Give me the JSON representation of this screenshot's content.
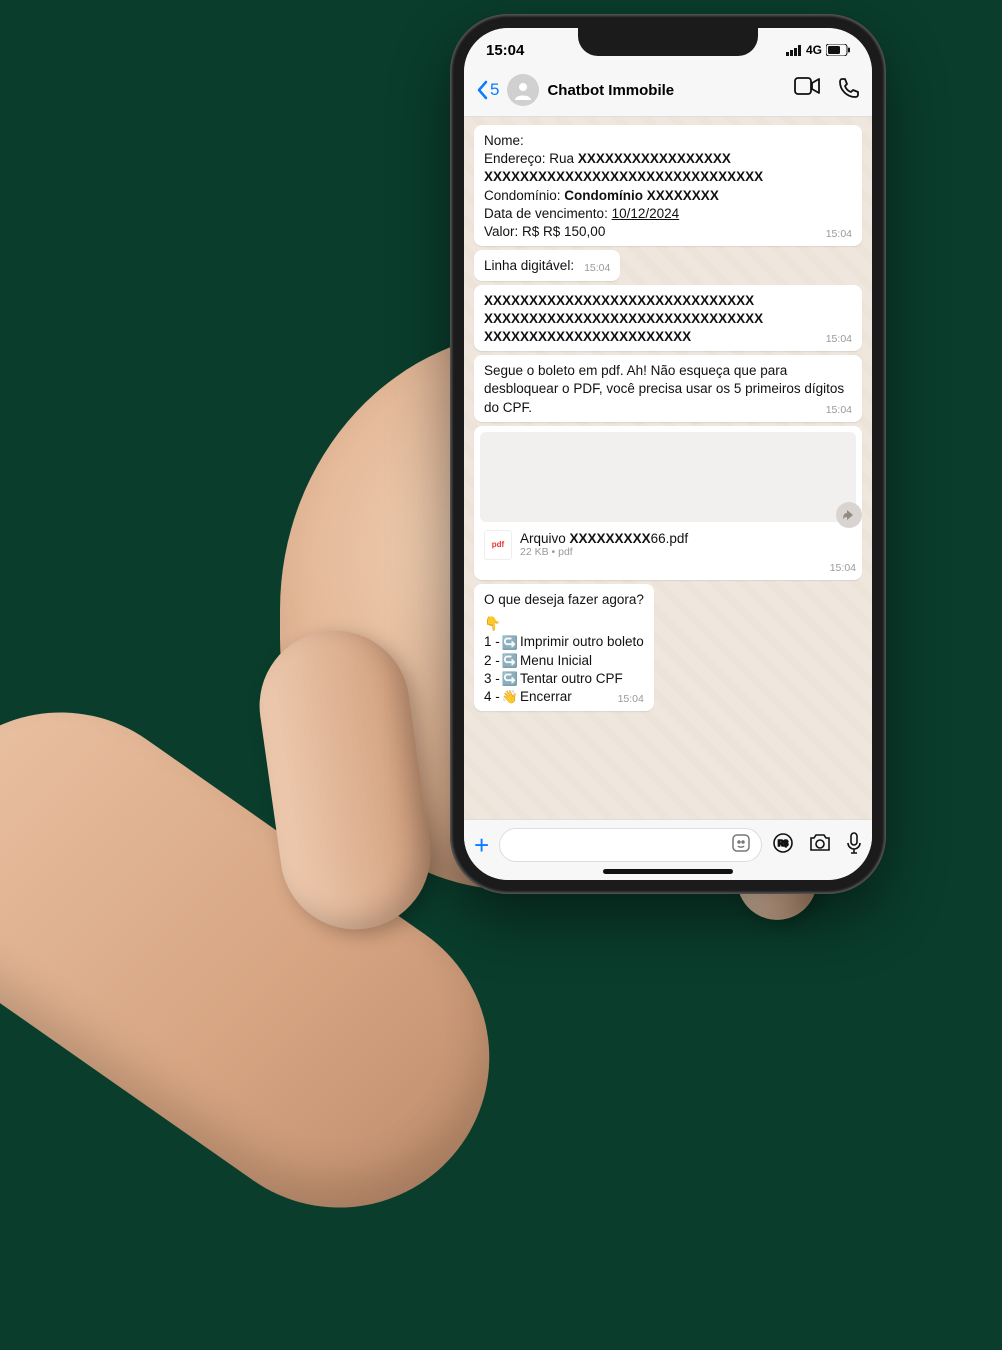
{
  "statusbar": {
    "time": "15:04",
    "network": "4G"
  },
  "header": {
    "back_count": "5",
    "title": "Chatbot Immobile"
  },
  "messages": {
    "m1": {
      "line1_label": "Nome:",
      "line2_label": "Endereço: Rua ",
      "line2_x": "XXXXXXXXXXXXXXXXX",
      "line2b_x": "XXXXXXXXXXXXXXXXXXXXXXXXXXXXXXX",
      "line3_label": "Condomínio: ",
      "line3_bold": "Condomínio",
      "line3_x": "  XXXXXXXX",
      "line4_label": "Data de vencimento: ",
      "line4_date": "10/12/2024",
      "line5": "Valor: R$ R$ 150,00",
      "time": "15:04"
    },
    "m2": {
      "text": "Linha digitável:",
      "time": "15:04"
    },
    "m3": {
      "l1": "XXXXXXXXXXXXXXXXXXXXXXXXXXXXXX",
      "l2": "XXXXXXXXXXXXXXXXXXXXXXXXXXXXXXX",
      "l3": "XXXXXXXXXXXXXXXXXXXXXXX",
      "time": "15:04"
    },
    "m4": {
      "text": "Segue o boleto em pdf. Ah! Não esqueça que para desbloquear o PDF, você precisa usar os 5 primeiros dígitos do CPF.",
      "time": "15:04"
    },
    "m5": {
      "file_label": "Arquivo",
      "file_x": "   XXXXXXXXX",
      "file_suffix": "66.pdf",
      "meta": "22 KB • pdf",
      "time": "15:04",
      "pdf_badge": "pdf"
    },
    "m6": {
      "q": "O que deseja fazer agora?",
      "emoji": "👇",
      "opt1_n": "1 - ",
      "opt1": "Imprimir outro boleto",
      "opt2_n": "2 - ",
      "opt2": "Menu Inicial",
      "opt3_n": "3 - ",
      "opt3": "Tentar outro CPF",
      "opt4_n": "4 - ",
      "opt4": "Encerrar",
      "time": "15:04"
    }
  }
}
